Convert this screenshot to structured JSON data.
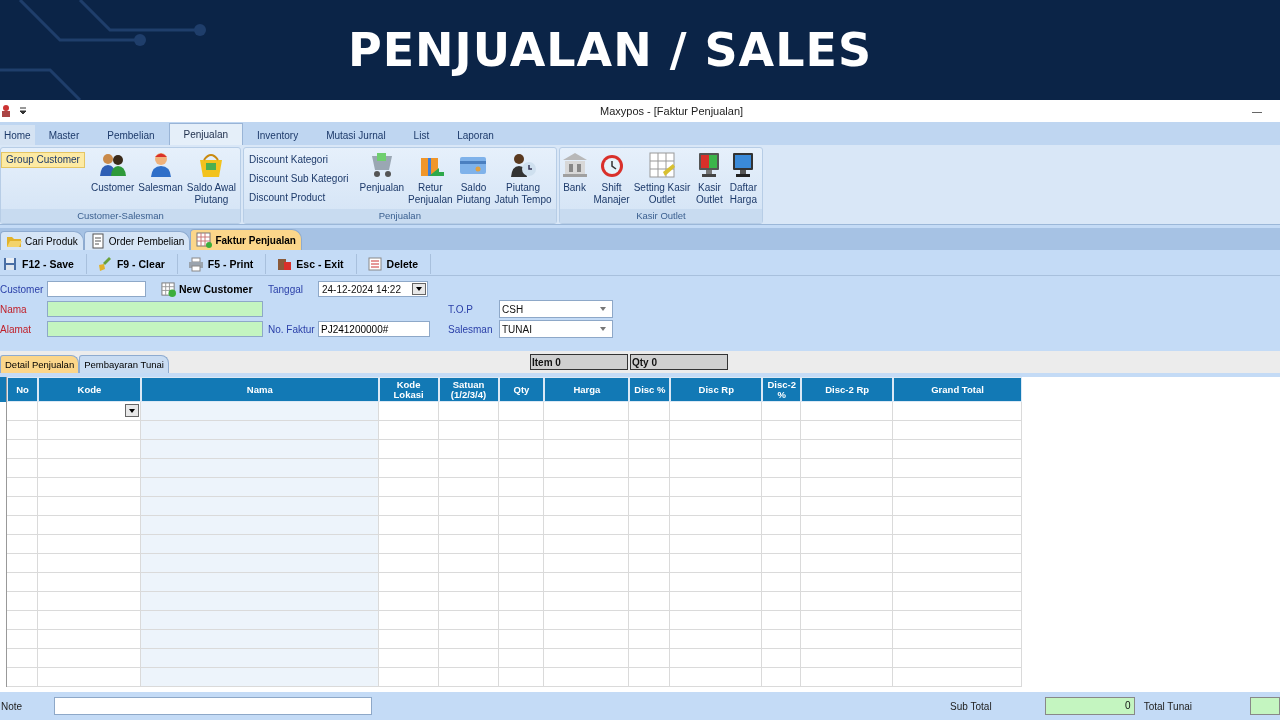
{
  "banner": {
    "title": "PENJUALAN / SALES"
  },
  "window": {
    "title": "Maxypos - [Faktur Penjualan]",
    "minimize": "—"
  },
  "ribbon_tabs": [
    {
      "label": "Home",
      "selected": false
    },
    {
      "label": "Master",
      "selected": false
    },
    {
      "label": "Pembelian",
      "selected": false
    },
    {
      "label": "Penjualan",
      "selected": true
    },
    {
      "label": "Inventory",
      "selected": false
    },
    {
      "label": "Mutasi Jurnal",
      "selected": false
    },
    {
      "label": "List",
      "selected": false
    },
    {
      "label": "Laporan",
      "selected": false
    }
  ],
  "ribbon_groups": [
    {
      "label": "Customer-Salesman",
      "small": [
        {
          "label": "Group Customer",
          "highlighted": true
        }
      ],
      "large": [
        {
          "label": "Customer"
        },
        {
          "label": "Salesman"
        },
        {
          "label": "Saldo Awal\nPiutang"
        }
      ]
    },
    {
      "label": "Penjualan",
      "small": [
        {
          "label": "Discount Kategori",
          "highlighted": false
        },
        {
          "label": "Discount Sub Kategori",
          "highlighted": false
        },
        {
          "label": "Discount Product",
          "highlighted": false
        }
      ],
      "large": [
        {
          "label": "Penjualan"
        },
        {
          "label": "Retur\nPenjualan"
        },
        {
          "label": "Saldo\nPiutang"
        },
        {
          "label": "Piutang\nJatuh Tempo"
        }
      ]
    },
    {
      "label": "Kasir Outlet",
      "large": [
        {
          "label": "Bank"
        },
        {
          "label": "Shift\nManajer"
        },
        {
          "label": "Setting Kasir\nOutlet"
        },
        {
          "label": "Kasir\nOutlet"
        },
        {
          "label": "Daftar\nHarga"
        }
      ]
    }
  ],
  "doc_tabs": [
    {
      "label": "Cari Produk",
      "selected": false
    },
    {
      "label": "Order Pembelian",
      "selected": false
    },
    {
      "label": "Faktur Penjualan",
      "selected": true
    }
  ],
  "toolbar": [
    "F12 - Save",
    "F9 - Clear",
    "F5 - Print",
    "Esc - Exit",
    "Delete"
  ],
  "form": {
    "customer": {
      "label": "Customer",
      "required": false
    },
    "new_customer": "New Customer",
    "tanggal": {
      "label": "Tanggal",
      "value": "24-12-2024 14:22",
      "required": false
    },
    "nama": {
      "label": "Nama",
      "required": true
    },
    "alamat": {
      "label": "Alamat",
      "required": true
    },
    "no_faktur": {
      "label": "No. Faktur",
      "value": "PJ241200000#",
      "required": false
    },
    "top": {
      "label": "T.O.P",
      "value": "CSH",
      "required": false
    },
    "salesman": {
      "label": "Salesman",
      "value": "TUNAI",
      "required": false
    }
  },
  "sub_tabs": [
    {
      "label": "Detail Penjualan",
      "selected": true
    },
    {
      "label": "Pembayaran Tunai",
      "selected": false
    }
  ],
  "summary": [
    "Item 0",
    "Qty 0"
  ],
  "table": {
    "columns": [
      "No",
      "Kode",
      "Nama",
      "Kode\nLokasi",
      "Satuan\n(1/2/3/4)",
      "Qty",
      "Harga",
      "Disc %",
      "Disc Rp",
      "Disc-2\n%",
      "Disc-2 Rp",
      "Grand Total"
    ]
  },
  "footer": {
    "note_label": "Note",
    "sub_total_label": "Sub Total",
    "sub_total": "0",
    "total_tunai_label": "Total Tunai"
  }
}
